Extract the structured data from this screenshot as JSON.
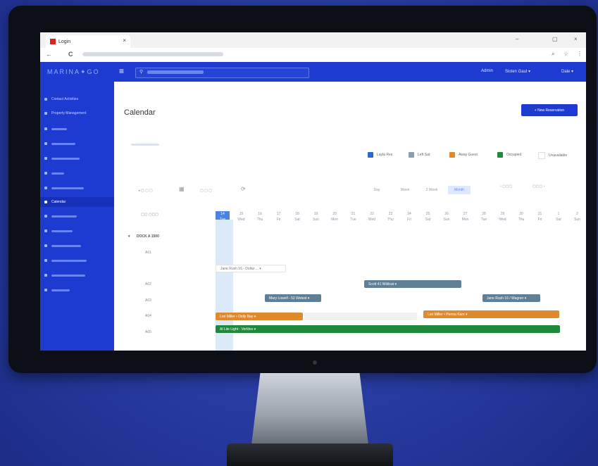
{
  "browser": {
    "tab_title": "Login",
    "tab_close": "×",
    "window_controls": [
      "–",
      "▢",
      "×"
    ],
    "back": "←",
    "reload": "C"
  },
  "app": {
    "logo": "MARINA✦GO",
    "header_links": [
      "Admin",
      "Sloten Gaul ▾",
      "Dale ▾"
    ]
  },
  "sidebar": {
    "items": [
      {
        "label": "Contact Activities"
      },
      {
        "label": "Property Management"
      },
      {
        "label": ""
      },
      {
        "label": ""
      },
      {
        "label": ""
      },
      {
        "label": ""
      },
      {
        "label": ""
      },
      {
        "label": "Calendar",
        "active": true
      },
      {
        "label": ""
      },
      {
        "label": ""
      },
      {
        "label": ""
      },
      {
        "label": ""
      },
      {
        "label": ""
      },
      {
        "label": ""
      }
    ]
  },
  "main": {
    "page_title": "Calendar",
    "new_button": "+ New Reservation",
    "legend": [
      {
        "label": "Layla Res",
        "color": "#2a68d4"
      },
      {
        "label": "Left Sat",
        "color": "#8d9db0"
      },
      {
        "label": "Away Guest",
        "color": "#e08a2e"
      },
      {
        "label": "Occupied",
        "color": "#1f8a3c"
      },
      {
        "label": "Unavailable",
        "color": "#dddddd"
      }
    ],
    "views": [
      "Day",
      "Week",
      "2 Week",
      "Month"
    ],
    "active_view": "Month",
    "group_label": "DOCK A 1500",
    "dates": [
      "14\nTue",
      "15\nWed",
      "16\nThu",
      "17\nFri",
      "18\nSat",
      "19\nSun",
      "20\nMon",
      "21\nTue",
      "22\nWed",
      "23\nThu",
      "24\nFri",
      "25\nSat",
      "26\nSun",
      "27\nMon",
      "28\nTue",
      "29\nWed",
      "30\nThu",
      "31\nFri",
      "1\nSat",
      "2\nSun"
    ],
    "row_labels": [
      "A01",
      "A02",
      "A03",
      "A04",
      "A05"
    ],
    "events": [
      {
        "label": "Jane Rush 16 - Dollar ... ▾",
        "style": "ghost"
      },
      {
        "label": "Mary Lowell - 52 Wetest ▾",
        "style": "gray"
      },
      {
        "label": "Scott 41 Wildcat ▾",
        "style": "gray"
      },
      {
        "label": "Jane Rush 16 / Wagner ▾",
        "style": "gray"
      },
      {
        "label": "Lori Miller • Dolly Bay ▾",
        "style": "orange"
      },
      {
        "label": "Lori Miller • Perma Kam ▾",
        "style": "orange"
      },
      {
        "label": "Al Lite Light - Vertline ▾",
        "style": "green"
      }
    ]
  }
}
